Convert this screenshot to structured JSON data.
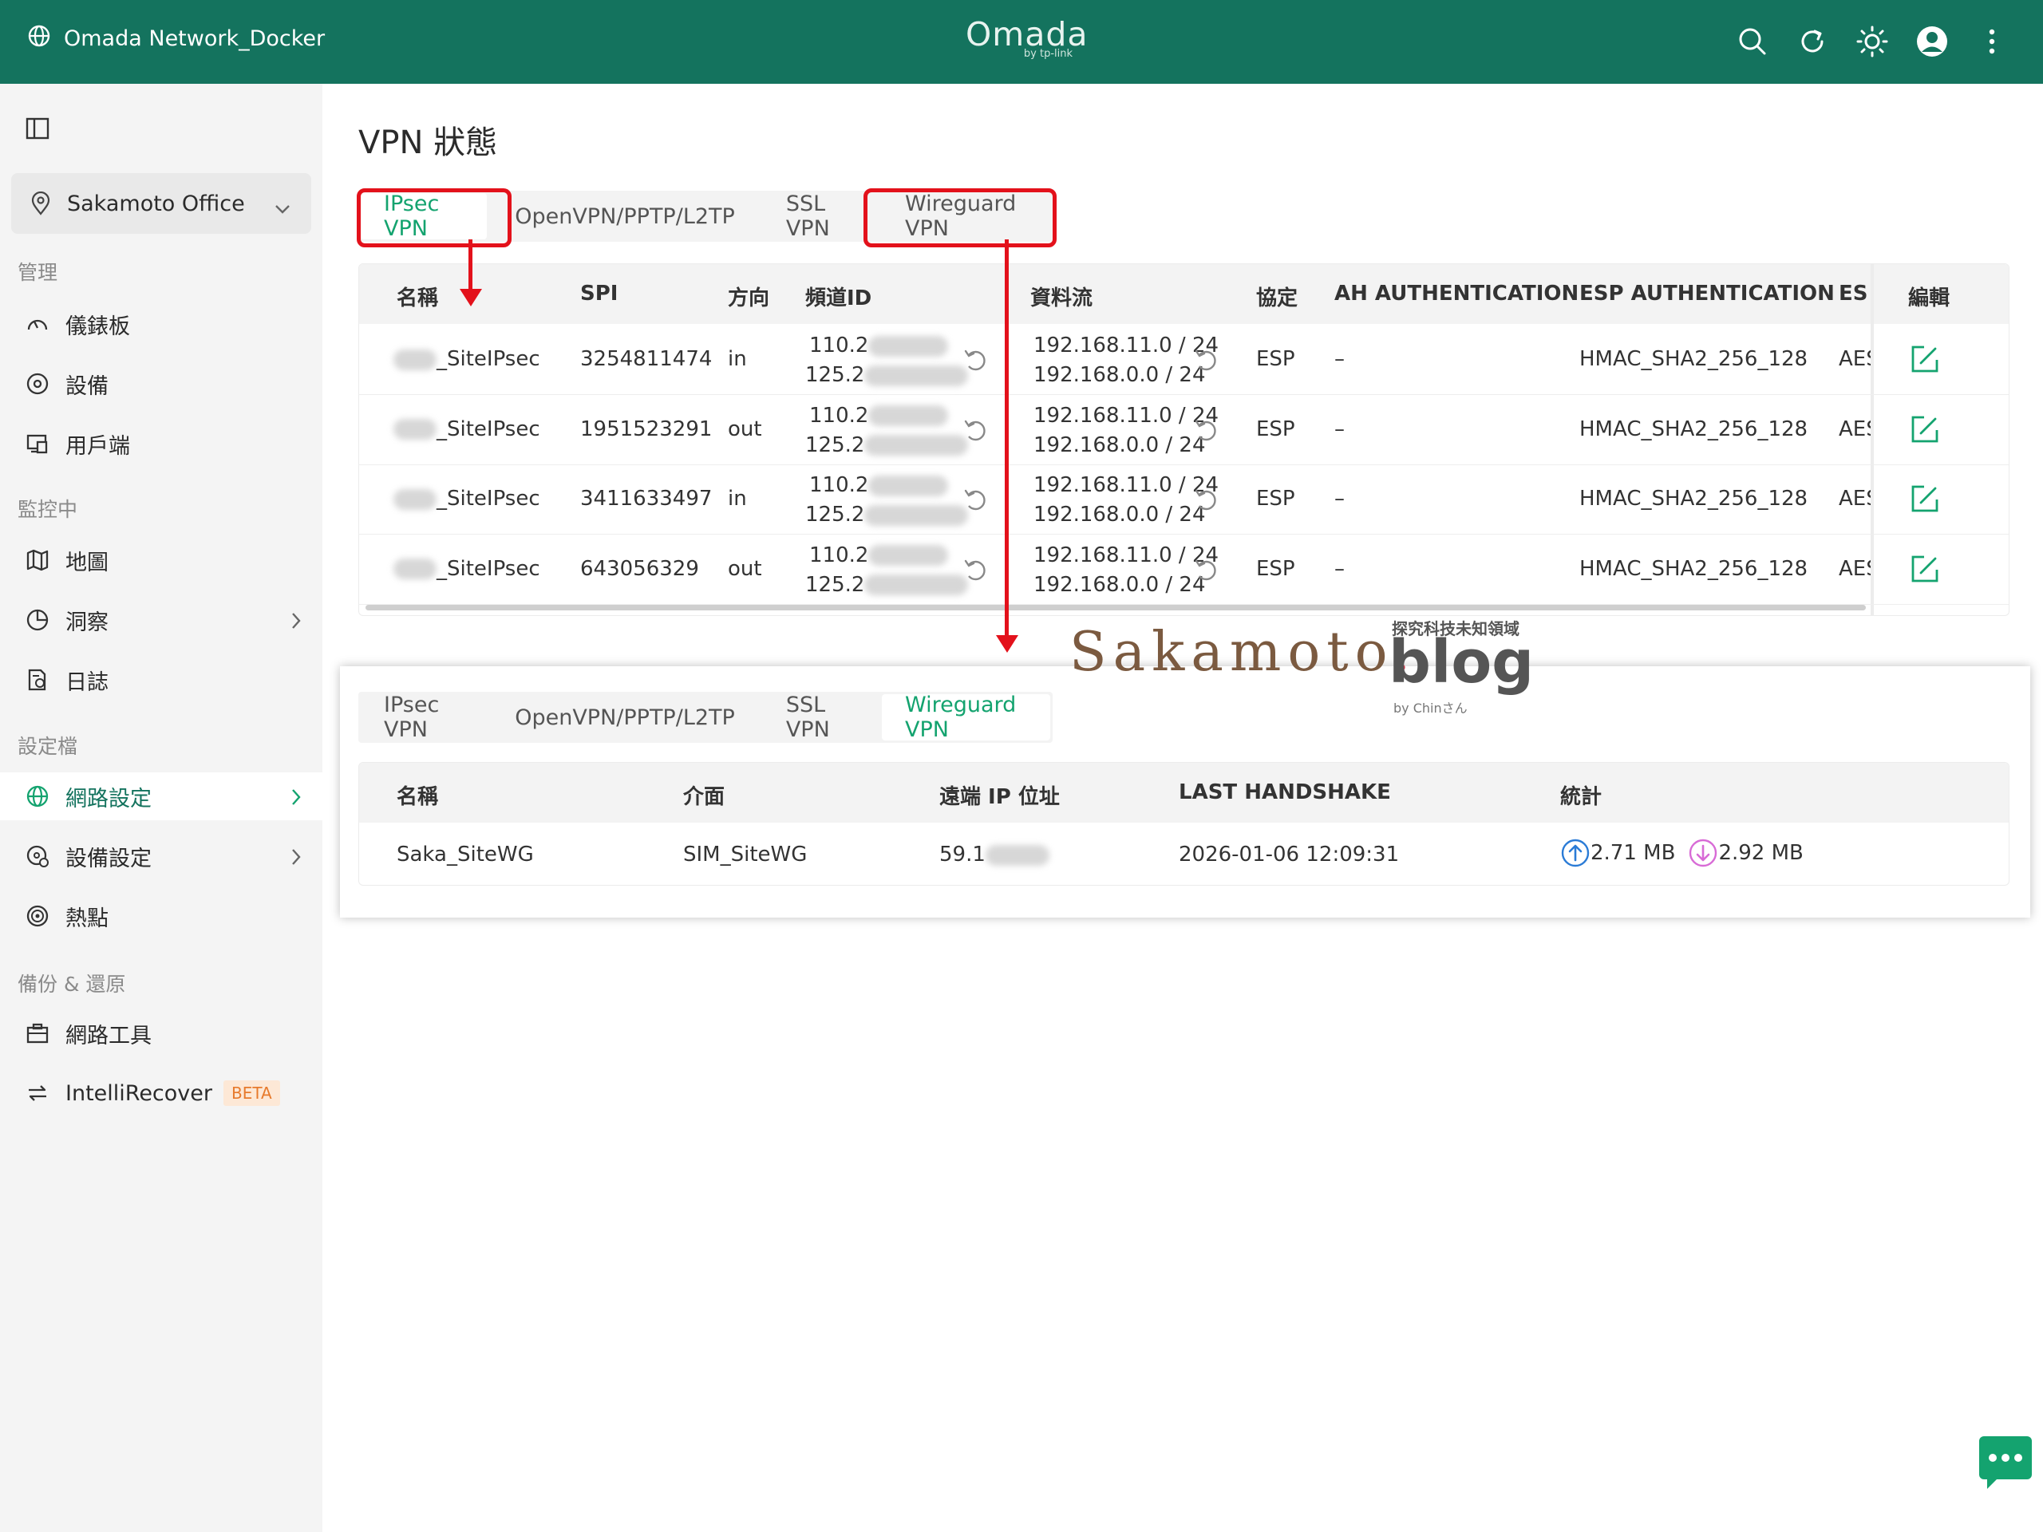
{
  "topbar": {
    "title": "Omada Network_Docker",
    "logo_main": "Omada",
    "logo_sub": "by tp-link",
    "accent": "#14735e"
  },
  "sidebar": {
    "site": "Sakamoto Office",
    "sections": [
      {
        "label": "管理",
        "items": [
          {
            "label": "儀錶板",
            "icon": "dashboard-icon"
          },
          {
            "label": "設備",
            "icon": "devices-icon"
          },
          {
            "label": "用戶端",
            "icon": "clients-icon"
          }
        ]
      },
      {
        "label": "監控中",
        "items": [
          {
            "label": "地圖",
            "icon": "map-icon"
          },
          {
            "label": "洞察",
            "icon": "insight-icon"
          },
          {
            "label": "日誌",
            "icon": "log-icon"
          }
        ]
      },
      {
        "label": "設定檔",
        "items": [
          {
            "label": "網路設定",
            "icon": "globe-icon"
          },
          {
            "label": "設備設定",
            "icon": "device-config-icon"
          },
          {
            "label": "熱點",
            "icon": "hotspot-icon"
          }
        ]
      },
      {
        "label": "備份 & 還原",
        "items": [
          {
            "label": "網路工具",
            "icon": "toolbox-icon"
          },
          {
            "label": "IntelliRecover",
            "icon": "recover-icon",
            "badge": "BETA"
          }
        ]
      }
    ]
  },
  "page": {
    "title": "VPN 狀態"
  },
  "tabs": [
    "IPsec VPN",
    "OpenVPN/PPTP/L2TP",
    "SSL VPN",
    "Wireguard VPN"
  ],
  "ipsec_table": {
    "headers": [
      "名稱",
      "SPI",
      "方向",
      "頻道ID",
      "資料流",
      "協定",
      "AH AUTHENTICATION",
      "ESP AUTHENTICATION",
      "ESP",
      "編輯"
    ],
    "rows": [
      {
        "name": "_SiteIPsec",
        "spi": "3254811474",
        "dir": "in",
        "ch1": "110.2",
        "ch2": "125.2",
        "flow1": "192.168.11.0 / 24",
        "flow2": "192.168.0.0 / 24",
        "proto": "ESP",
        "ah": "–",
        "esp_auth": "HMAC_SHA2_256_128",
        "esp": "AES"
      },
      {
        "name": "_SiteIPsec",
        "spi": "1951523291",
        "dir": "out",
        "ch1": "110.2",
        "ch2": "125.2",
        "flow1": "192.168.11.0 / 24",
        "flow2": "192.168.0.0 / 24",
        "proto": "ESP",
        "ah": "–",
        "esp_auth": "HMAC_SHA2_256_128",
        "esp": "AES"
      },
      {
        "name": "_SiteIPsec",
        "spi": "3411633497",
        "dir": "in",
        "ch1": "110.2",
        "ch2": "125.2",
        "flow1": "192.168.11.0 / 24",
        "flow2": "192.168.0.0 / 24",
        "proto": "ESP",
        "ah": "–",
        "esp_auth": "HMAC_SHA2_256_128",
        "esp": "AES"
      },
      {
        "name": "_SiteIPsec",
        "spi": "643056329",
        "dir": "out",
        "ch1": "110.2",
        "ch2": "125.2",
        "flow1": "192.168.11.0 / 24",
        "flow2": "192.168.0.0 / 24",
        "proto": "ESP",
        "ah": "–",
        "esp_auth": "HMAC_SHA2_256_128",
        "esp": "AES"
      }
    ]
  },
  "wg_table": {
    "headers": [
      "名稱",
      "介面",
      "遠端 IP 位址",
      "LAST HANDSHAKE",
      "統計"
    ],
    "rows": [
      {
        "name": "Saka_SiteWG",
        "iface": "SIM_SiteWG",
        "remote": "59.1",
        "handshake": "2026-01-06 12:09:31",
        "up": "2.71 MB",
        "down": "2.92 MB"
      }
    ]
  },
  "watermark": {
    "brand": "Sakamoto",
    "dot": ".",
    "blog": "blog",
    "tagline": "探究科技未知領域",
    "by": "by Chinさん"
  }
}
